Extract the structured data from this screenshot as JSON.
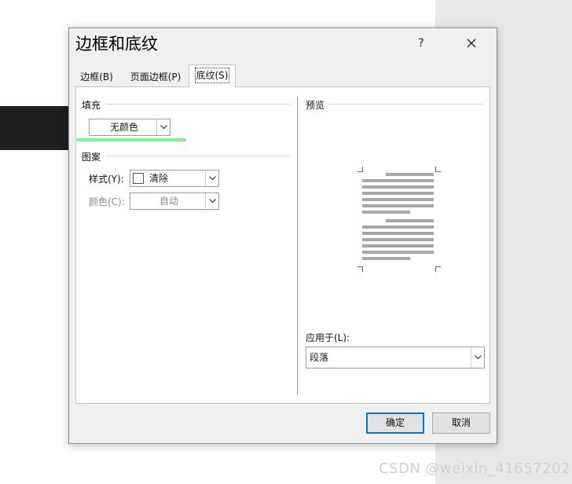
{
  "dialog": {
    "title": "边框和底纹",
    "help_label": "?",
    "close_icon": "close-icon"
  },
  "tabs": [
    {
      "label": "边框(B)",
      "active": false
    },
    {
      "label": "页面边框(P)",
      "active": false
    },
    {
      "label": "底纹(S)",
      "active": true
    }
  ],
  "fill": {
    "section_title": "填充",
    "color_value": "无颜色"
  },
  "pattern": {
    "section_title": "图案",
    "style_label": "样式(Y):",
    "style_value": "清除",
    "color_label": "颜色(C):",
    "color_value": "自动"
  },
  "preview": {
    "section_title": "预览",
    "apply_label": "应用于(L):",
    "apply_value": "段落"
  },
  "buttons": {
    "ok": "确定",
    "cancel": "取消"
  },
  "annotation": {
    "highlight_color": "#7df58f"
  },
  "watermark": "CSDN @weixin_41657202"
}
